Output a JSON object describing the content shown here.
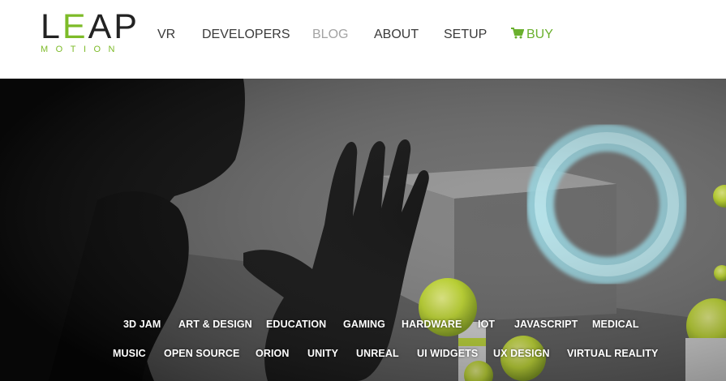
{
  "logo": {
    "word_left": "L",
    "word_accent": "E",
    "word_right": "AP",
    "subtitle": "MOTION"
  },
  "nav": {
    "items": [
      {
        "label": "VR"
      },
      {
        "label": "DEVELOPERS"
      },
      {
        "label": "BLOG",
        "state": "active"
      },
      {
        "label": "ABOUT"
      },
      {
        "label": "SETUP"
      },
      {
        "label": "BUY",
        "icon": "shopping-cart-icon"
      }
    ]
  },
  "hero": {
    "tag_row_1": [
      "3D JAM",
      "ART & DESIGN",
      "EDUCATION",
      "GAMING",
      "HARDWARE",
      "IOT",
      "JAVASCRIPT",
      "MEDICAL"
    ],
    "tag_row_2": [
      "MUSIC",
      "OPEN SOURCE",
      "ORION",
      "UNITY",
      "UNREAL",
      "UI WIDGETS",
      "UX DESIGN",
      "VIRTUAL REALITY"
    ]
  },
  "colors": {
    "brand_green": "#7dbb28",
    "nav_text": "#3a3a3a",
    "nav_active": "#a3a3a3",
    "buy_green": "#6ab02d",
    "ring": "#8fd3e0",
    "ball": "#c9e23a"
  }
}
